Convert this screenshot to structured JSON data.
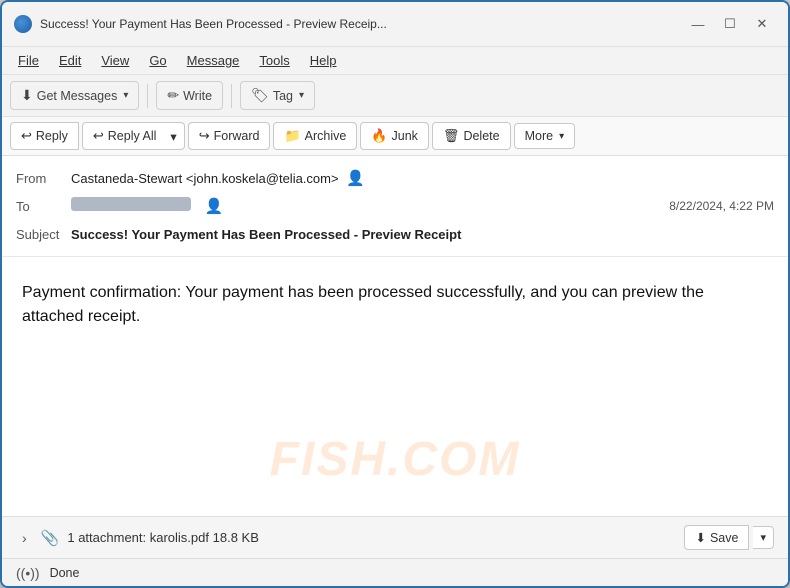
{
  "window": {
    "title": "Success! Your Payment Has Been Processed - Preview Receip...",
    "app_icon": "thunderbird"
  },
  "window_controls": {
    "minimize": "—",
    "maximize": "☐",
    "close": "✕"
  },
  "menu": {
    "items": [
      "File",
      "Edit",
      "View",
      "Go",
      "Message",
      "Tools",
      "Help"
    ]
  },
  "toolbar": {
    "get_messages": "Get Messages",
    "get_messages_dropdown": "▾",
    "write": "Write",
    "tag": "Tag",
    "tag_dropdown": "▾"
  },
  "action_bar": {
    "reply": "Reply",
    "reply_all": "Reply All",
    "forward": "Forward",
    "archive": "Archive",
    "junk": "Junk",
    "delete": "Delete",
    "more": "More",
    "more_dropdown": "▾"
  },
  "email": {
    "from_label": "From",
    "from_name": "Castaneda-Stewart",
    "from_email": "<john.koskela@telia.com>",
    "to_label": "To",
    "date": "8/22/2024, 4:22 PM",
    "subject_label": "Subject",
    "subject": "Success! Your Payment Has Been Processed - Preview Receipt",
    "body": "Payment confirmation: Your payment has been processed successfully, and you can preview the attached receipt."
  },
  "attachment": {
    "label": "1 attachment: karolis.pdf",
    "size": "18.8 KB",
    "save_btn": "Save"
  },
  "status": {
    "text": "Done"
  },
  "watermark": "FISH.COM"
}
